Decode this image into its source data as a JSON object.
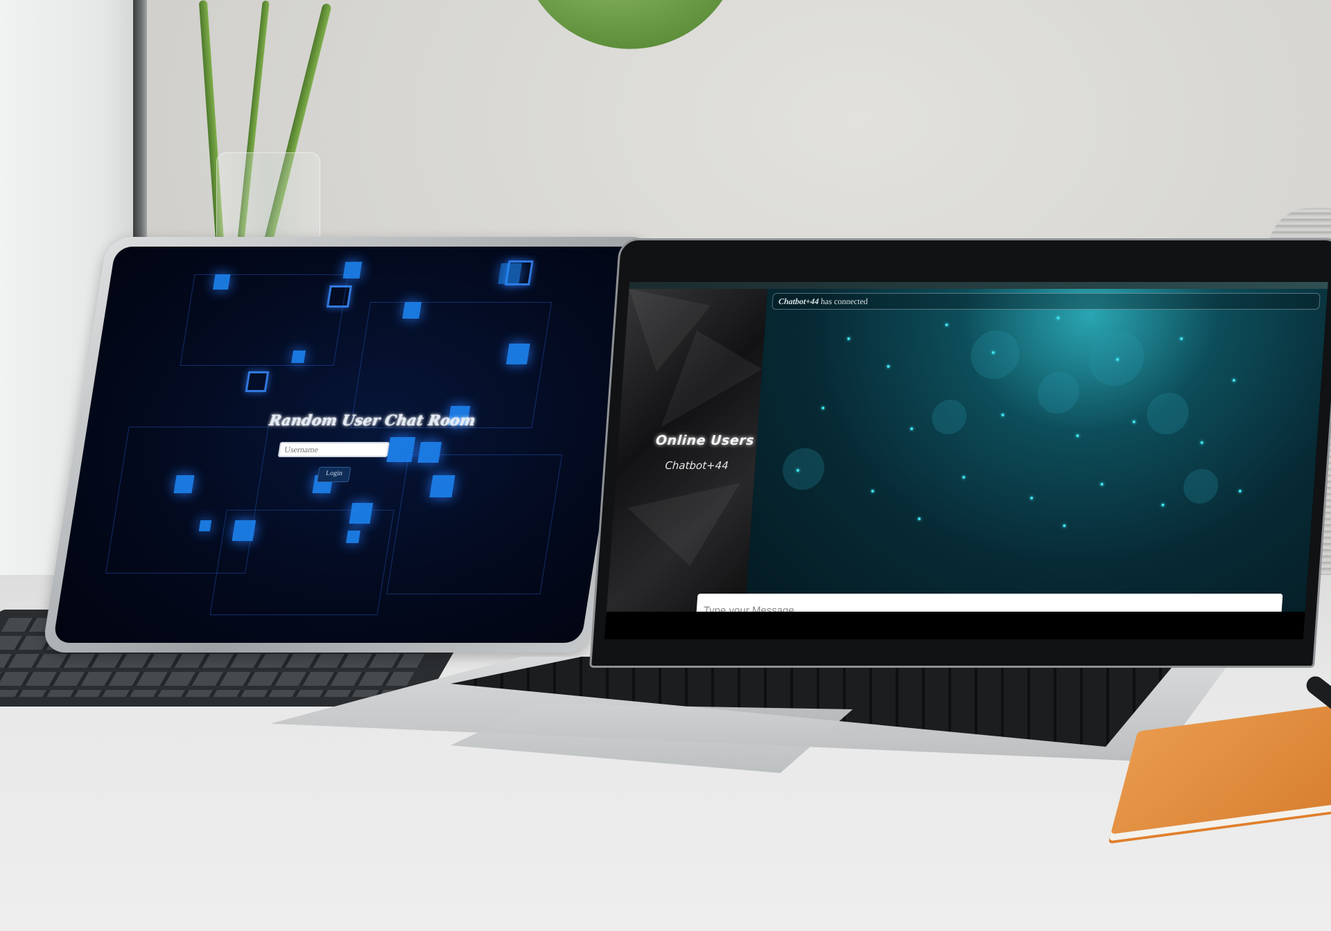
{
  "tablet": {
    "app_title": "Random User Chat Room",
    "username_placeholder": "Username",
    "login_label": "Login"
  },
  "laptop": {
    "notification": {
      "user": "Chatbot+44",
      "text": "has connected"
    },
    "sidebar": {
      "title": "Online Users",
      "users": [
        "Chatbot+44"
      ]
    },
    "message_placeholder": "Type your Message ..."
  },
  "colors": {
    "tablet_accent": "#1f8cff",
    "chat_teal": "#0d4d5a",
    "sidebar_dark": "#1a1a1c"
  }
}
